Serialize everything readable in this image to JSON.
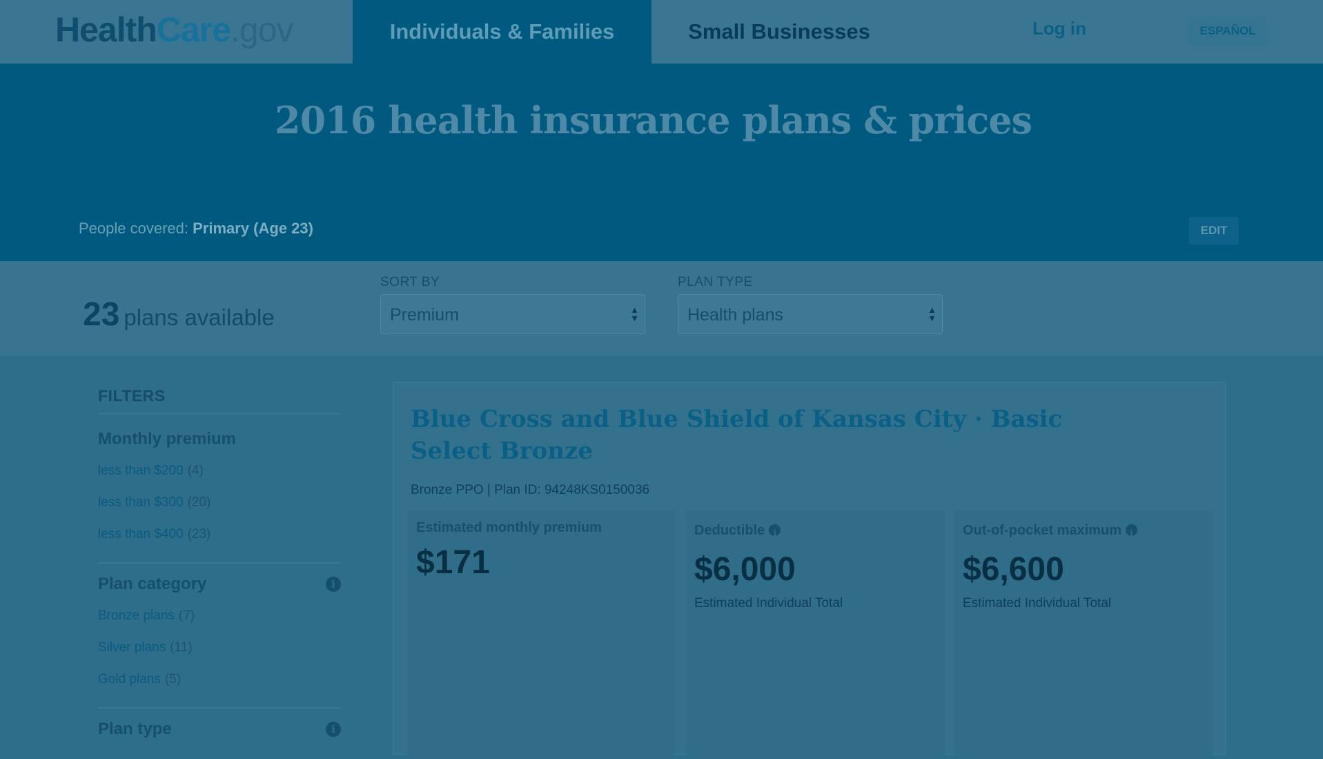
{
  "nav": {
    "logo_health": "Health",
    "logo_care": "Care",
    "logo_gov": ".gov",
    "tab_individuals": "Individuals & Families",
    "tab_small_business": "Small Businesses",
    "login": "Log in",
    "espanol": "ESPAÑOL"
  },
  "hero": {
    "title": "2016 health insurance plans & prices",
    "people_label": "People covered:",
    "people_value": "Primary (Age 23)",
    "edit": "EDIT"
  },
  "controls": {
    "plans_count": "23",
    "plans_text": "plans available",
    "sort_label": "SORT BY",
    "sort_value": "Premium",
    "type_label": "PLAN TYPE",
    "type_value": "Health plans"
  },
  "filters": {
    "heading": "FILTERS",
    "monthly_premium": {
      "title": "Monthly premium",
      "items": [
        {
          "label": "less than $200",
          "count": "(4)"
        },
        {
          "label": "less than $300",
          "count": "(20)"
        },
        {
          "label": "less than $400",
          "count": "(23)"
        }
      ]
    },
    "plan_category": {
      "title": "Plan category",
      "items": [
        {
          "label": "Bronze plans",
          "count": "(7)"
        },
        {
          "label": "Silver plans",
          "count": "(11)"
        },
        {
          "label": "Gold plans",
          "count": "(5)"
        }
      ]
    },
    "plan_type": {
      "title": "Plan type"
    }
  },
  "plan": {
    "title": "Blue Cross and Blue Shield of Kansas City · Basic Select Bronze",
    "subtitle": "Bronze PPO | Plan ID: 94248KS0150036",
    "premium_label": "Estimated monthly premium",
    "premium_value": "$171",
    "deductible_label": "Deductible",
    "deductible_value": "$6,000",
    "deductible_note": "Estimated Individual Total",
    "oop_label": "Out-of-pocket maximum",
    "oop_value": "$6,600",
    "oop_note": "Estimated Individual Total"
  },
  "icons": {
    "info": "info-icon",
    "select_arrows": "up-down-arrows-icon"
  }
}
